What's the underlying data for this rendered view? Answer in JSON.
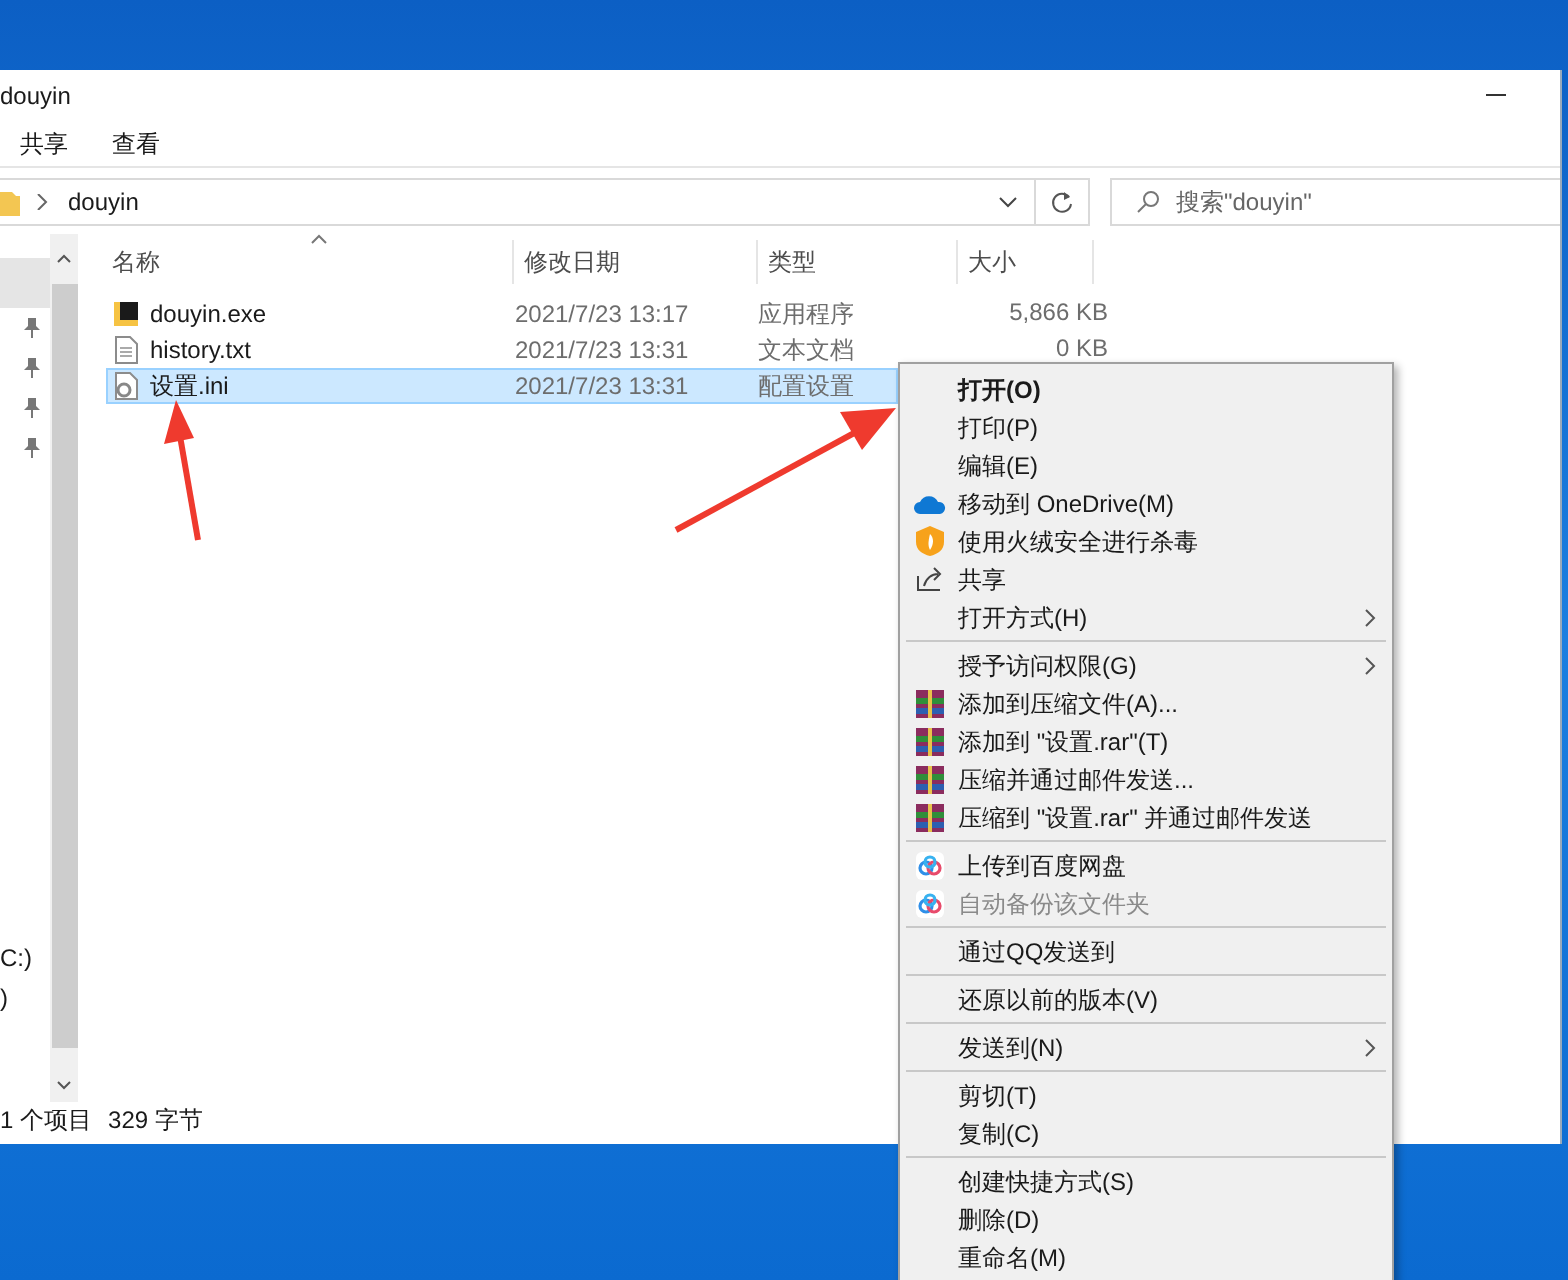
{
  "window": {
    "title": "douyin"
  },
  "ribbon_tabs": [
    {
      "label": "共享"
    },
    {
      "label": "查看"
    }
  ],
  "address_bar": {
    "path": "douyin"
  },
  "search": {
    "placeholder": "搜索\"douyin\""
  },
  "sidebar": {
    "items": [
      {
        "label": "C:)"
      },
      {
        "label": ")"
      }
    ]
  },
  "table": {
    "columns": [
      "名称",
      "修改日期",
      "类型",
      "大小"
    ],
    "rows": [
      {
        "kind": "application",
        "name": "douyin.exe",
        "date": "2021/7/23 13:17",
        "type": "应用程序",
        "size": "5,866 KB",
        "selected": false
      },
      {
        "kind": "text",
        "name": "history.txt",
        "date": "2021/7/23 13:31",
        "type": "文本文档",
        "size": "0 KB",
        "selected": false
      },
      {
        "kind": "config",
        "name": "设置.ini",
        "date": "2021/7/23 13:31",
        "type": "配置设置",
        "size": "",
        "selected": true
      }
    ]
  },
  "status_bar": {
    "count": "1 个项目",
    "size": "329 字节"
  },
  "context_menu": [
    {
      "kind": "plain",
      "label": "打开(O)",
      "default": true,
      "disabled": false,
      "submenu": false
    },
    {
      "kind": "plain",
      "label": "打印(P)",
      "default": false,
      "disabled": false,
      "submenu": false
    },
    {
      "kind": "plain",
      "label": "编辑(E)",
      "default": false,
      "disabled": false,
      "submenu": false
    },
    {
      "kind": "cloud",
      "label": "移动到 OneDrive(M)",
      "default": false,
      "disabled": false,
      "submenu": false
    },
    {
      "kind": "shield",
      "label": "使用火绒安全进行杀毒",
      "default": false,
      "disabled": false,
      "submenu": false
    },
    {
      "kind": "share",
      "label": "共享",
      "default": false,
      "disabled": false,
      "submenu": false
    },
    {
      "kind": "plain",
      "label": "打开方式(H)",
      "default": false,
      "disabled": false,
      "submenu": true
    },
    {
      "kind": "separator"
    },
    {
      "kind": "plain",
      "label": "授予访问权限(G)",
      "default": false,
      "disabled": false,
      "submenu": true
    },
    {
      "kind": "archive",
      "label": "添加到压缩文件(A)...",
      "default": false,
      "disabled": false,
      "submenu": false
    },
    {
      "kind": "archive",
      "label": "添加到 \"设置.rar\"(T)",
      "default": false,
      "disabled": false,
      "submenu": false
    },
    {
      "kind": "archive",
      "label": "压缩并通过邮件发送...",
      "default": false,
      "disabled": false,
      "submenu": false
    },
    {
      "kind": "archive",
      "label": "压缩到 \"设置.rar\" 并通过邮件发送",
      "default": false,
      "disabled": false,
      "submenu": false
    },
    {
      "kind": "separator"
    },
    {
      "kind": "netdisk",
      "label": "上传到百度网盘",
      "default": false,
      "disabled": false,
      "submenu": false
    },
    {
      "kind": "netdisk",
      "label": "自动备份该文件夹",
      "default": false,
      "disabled": true,
      "submenu": false
    },
    {
      "kind": "separator"
    },
    {
      "kind": "plain",
      "label": "通过QQ发送到",
      "default": false,
      "disabled": false,
      "submenu": false
    },
    {
      "kind": "separator"
    },
    {
      "kind": "plain",
      "label": "还原以前的版本(V)",
      "default": false,
      "disabled": false,
      "submenu": false
    },
    {
      "kind": "separator"
    },
    {
      "kind": "plain",
      "label": "发送到(N)",
      "default": false,
      "disabled": false,
      "submenu": true
    },
    {
      "kind": "separator"
    },
    {
      "kind": "plain",
      "label": "剪切(T)",
      "default": false,
      "disabled": false,
      "submenu": false
    },
    {
      "kind": "plain",
      "label": "复制(C)",
      "default": false,
      "disabled": false,
      "submenu": false
    },
    {
      "kind": "separator"
    },
    {
      "kind": "plain",
      "label": "创建快捷方式(S)",
      "default": false,
      "disabled": false,
      "submenu": false
    },
    {
      "kind": "plain",
      "label": "删除(D)",
      "default": false,
      "disabled": false,
      "submenu": false
    },
    {
      "kind": "plain",
      "label": "重命名(M)",
      "default": false,
      "disabled": false,
      "submenu": false
    }
  ]
}
